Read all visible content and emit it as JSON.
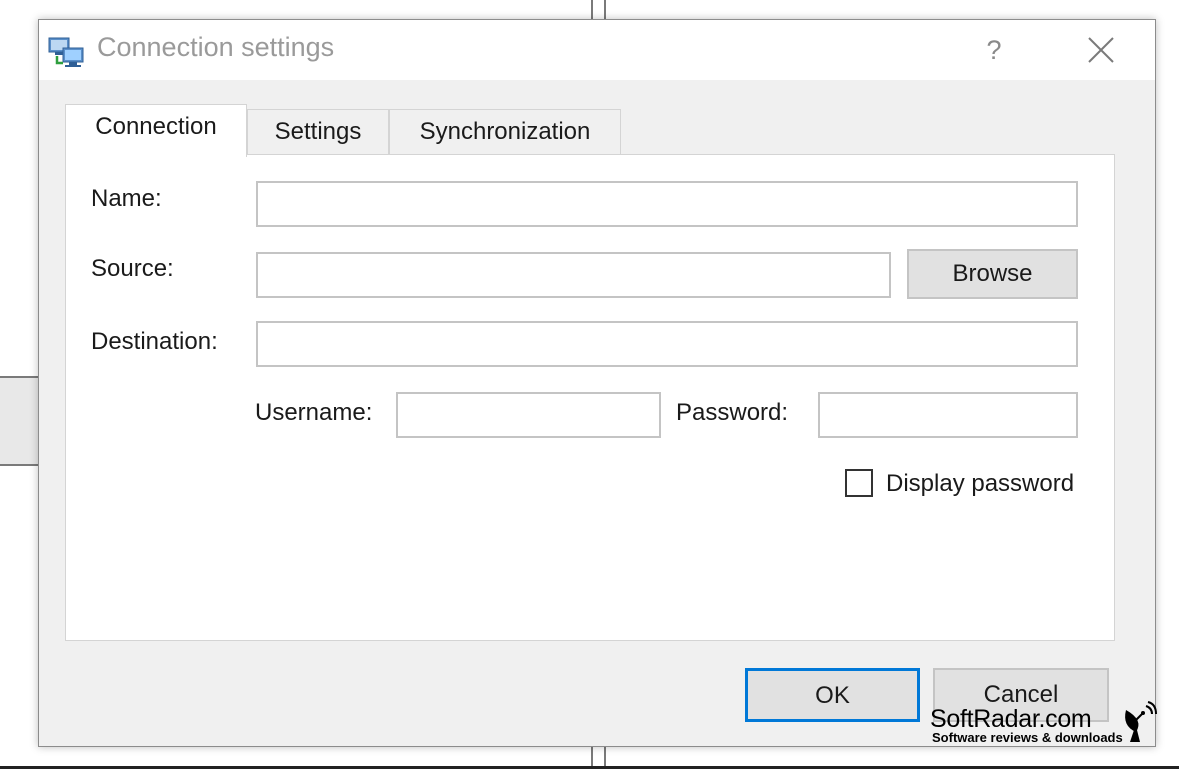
{
  "dialog": {
    "title": "Connection settings",
    "help_label": "?",
    "close_icon": "close-icon",
    "app_icon": "network-computers-icon"
  },
  "tabs": [
    {
      "label": "Connection",
      "active": true
    },
    {
      "label": "Settings",
      "active": false
    },
    {
      "label": "Synchronization",
      "active": false
    }
  ],
  "form": {
    "name_label": "Name:",
    "name_value": "",
    "source_label": "Source:",
    "source_value": "",
    "browse_label": "Browse",
    "destination_label": "Destination:",
    "destination_value": "",
    "username_label": "Username:",
    "username_value": "",
    "password_label": "Password:",
    "password_value": "",
    "display_password_label": "Display password",
    "display_password_checked": false
  },
  "footer": {
    "ok_label": "OK",
    "cancel_label": "Cancel"
  },
  "watermark": {
    "name": "SoftRadar.com",
    "tagline": "Software reviews & downloads"
  },
  "colors": {
    "focus_border": "#0078d7",
    "title_text": "#9a9a9a",
    "dialog_bg": "#f0f0f0"
  }
}
